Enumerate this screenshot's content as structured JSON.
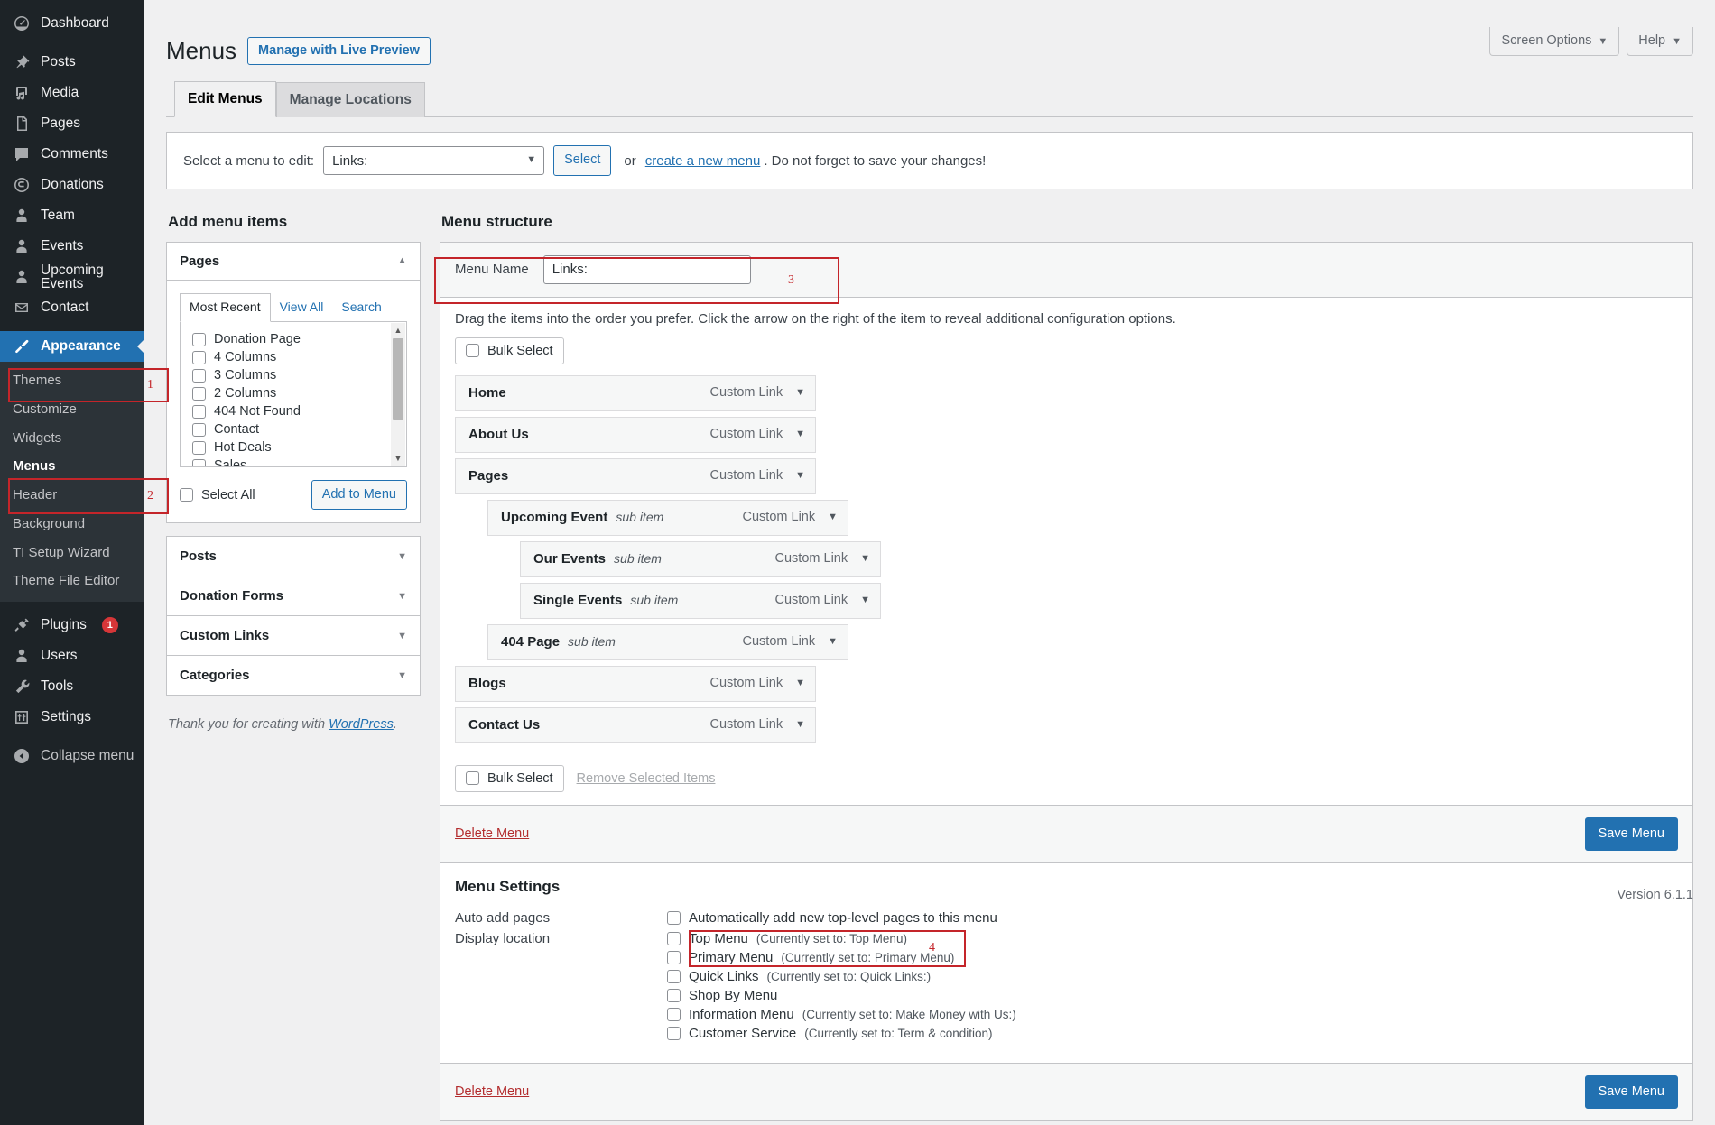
{
  "sidebar": {
    "items": [
      {
        "label": "Dashboard",
        "icon": "dashboard-icon"
      },
      {
        "label": "Posts",
        "icon": "pin-icon"
      },
      {
        "label": "Media",
        "icon": "media-icon"
      },
      {
        "label": "Pages",
        "icon": "page-icon"
      },
      {
        "label": "Comments",
        "icon": "comment-icon"
      },
      {
        "label": "Donations",
        "icon": "donation-icon"
      },
      {
        "label": "Team",
        "icon": "user-icon"
      },
      {
        "label": "Events",
        "icon": "user-icon"
      },
      {
        "label": "Upcoming Events",
        "icon": "user-icon"
      },
      {
        "label": "Contact",
        "icon": "mail-icon"
      }
    ],
    "appearance": {
      "label": "Appearance",
      "icon": "brush-icon"
    },
    "appearance_submenu": [
      {
        "label": "Themes"
      },
      {
        "label": "Customize"
      },
      {
        "label": "Widgets"
      },
      {
        "label": "Menus"
      },
      {
        "label": "Header"
      },
      {
        "label": "Background"
      },
      {
        "label": "TI Setup Wizard"
      },
      {
        "label": "Theme File Editor"
      }
    ],
    "bottom_items": [
      {
        "label": "Plugins",
        "icon": "plug-icon",
        "badge": "1"
      },
      {
        "label": "Users",
        "icon": "user-icon",
        "badge": ""
      },
      {
        "label": "Tools",
        "icon": "wrench-icon",
        "badge": ""
      },
      {
        "label": "Settings",
        "icon": "sliders-icon",
        "badge": ""
      }
    ],
    "collapse": {
      "label": "Collapse menu",
      "icon": "collapse-icon"
    }
  },
  "screen_meta": {
    "screen_options": "Screen Options",
    "help": "Help",
    "caret": "▼"
  },
  "header": {
    "title": "Menus",
    "live_preview_button": "Manage with Live Preview",
    "tabs": [
      {
        "label": "Edit Menus",
        "active": true
      },
      {
        "label": "Manage Locations",
        "active": false
      }
    ]
  },
  "menu_selector": {
    "label": "Select a menu to edit:",
    "selected": "Links:",
    "select_button": "Select",
    "or_text": "or",
    "create_link": "create a new menu",
    "tail_text": ". Do not forget to save your changes!"
  },
  "add_menu_items": {
    "title": "Add menu items",
    "pages_panel": {
      "heading": "Pages",
      "collapse_icon": "▲",
      "tabs": [
        {
          "label": "Most Recent",
          "active": true
        },
        {
          "label": "View All",
          "active": false
        },
        {
          "label": "Search",
          "active": false
        }
      ],
      "pages": [
        "Donation Page",
        "4 Columns",
        "3 Columns",
        "2 Columns",
        "404 Not Found",
        "Contact",
        "Hot Deals",
        "Sales"
      ],
      "select_all": "Select All",
      "add_to_menu": "Add to Menu"
    },
    "panels": [
      {
        "label": "Posts",
        "icon": "▼"
      },
      {
        "label": "Donation Forms",
        "icon": "▼"
      },
      {
        "label": "Custom Links",
        "icon": "▼"
      },
      {
        "label": "Categories",
        "icon": "▼"
      }
    ]
  },
  "menu_structure": {
    "title": "Menu structure",
    "menu_name_label": "Menu Name",
    "menu_name_value": "Links:",
    "drag_hint": "Drag the items into the order you prefer. Click the arrow on the right of the item to reveal additional configuration options.",
    "bulk_select_top": "Bulk Select",
    "bulk_select_bottom": "Bulk Select",
    "remove_selected": "Remove Selected Items",
    "items": [
      {
        "title": "Home",
        "sub": "",
        "type": "Custom Link",
        "depth": 0
      },
      {
        "title": "About Us",
        "sub": "",
        "type": "Custom Link",
        "depth": 0
      },
      {
        "title": "Pages",
        "sub": "",
        "type": "Custom Link",
        "depth": 0
      },
      {
        "title": "Upcoming Event",
        "sub": "sub item",
        "type": "Custom Link",
        "depth": 1
      },
      {
        "title": "Our Events",
        "sub": "sub item",
        "type": "Custom Link",
        "depth": 2
      },
      {
        "title": "Single Events",
        "sub": "sub item",
        "type": "Custom Link",
        "depth": 2
      },
      {
        "title": "404 Page",
        "sub": "sub item",
        "type": "Custom Link",
        "depth": 1
      },
      {
        "title": "Blogs",
        "sub": "",
        "type": "Custom Link",
        "depth": 0
      },
      {
        "title": "Contact Us",
        "sub": "",
        "type": "Custom Link",
        "depth": 0
      }
    ]
  },
  "action_bar": {
    "delete_menu": "Delete Menu",
    "save_menu": "Save Menu"
  },
  "menu_settings": {
    "title": "Menu Settings",
    "auto_add_label": "Auto add pages",
    "auto_add_text": "Automatically add new top-level pages to this menu",
    "display_location_label": "Display location",
    "locations": [
      {
        "name": "Top Menu",
        "current": "(Currently set to: Top Menu)"
      },
      {
        "name": "Primary Menu",
        "current": "(Currently set to: Primary Menu)"
      },
      {
        "name": "Quick Links",
        "current": "(Currently set to: Quick Links:)"
      },
      {
        "name": "Shop By Menu",
        "current": ""
      },
      {
        "name": "Information Menu",
        "current": "(Currently set to: Make Money with Us:)"
      },
      {
        "name": "Customer Service",
        "current": "(Currently set to: Term & condition)"
      }
    ]
  },
  "footer": {
    "credit_prefix": "Thank you for creating with ",
    "credit_link": "WordPress",
    "credit_suffix": ".",
    "version": "Version 6.1.1"
  },
  "annotations": [
    {
      "number": "1"
    },
    {
      "number": "2"
    },
    {
      "number": "3"
    },
    {
      "number": "4"
    }
  ],
  "colors": {
    "sidebar_bg": "#1d2327",
    "submenu_bg": "#2c3338",
    "accent_blue": "#2271b1",
    "annotation_red": "#c4252a",
    "danger_red": "#b32d2e",
    "page_bg": "#f0f0f1"
  }
}
